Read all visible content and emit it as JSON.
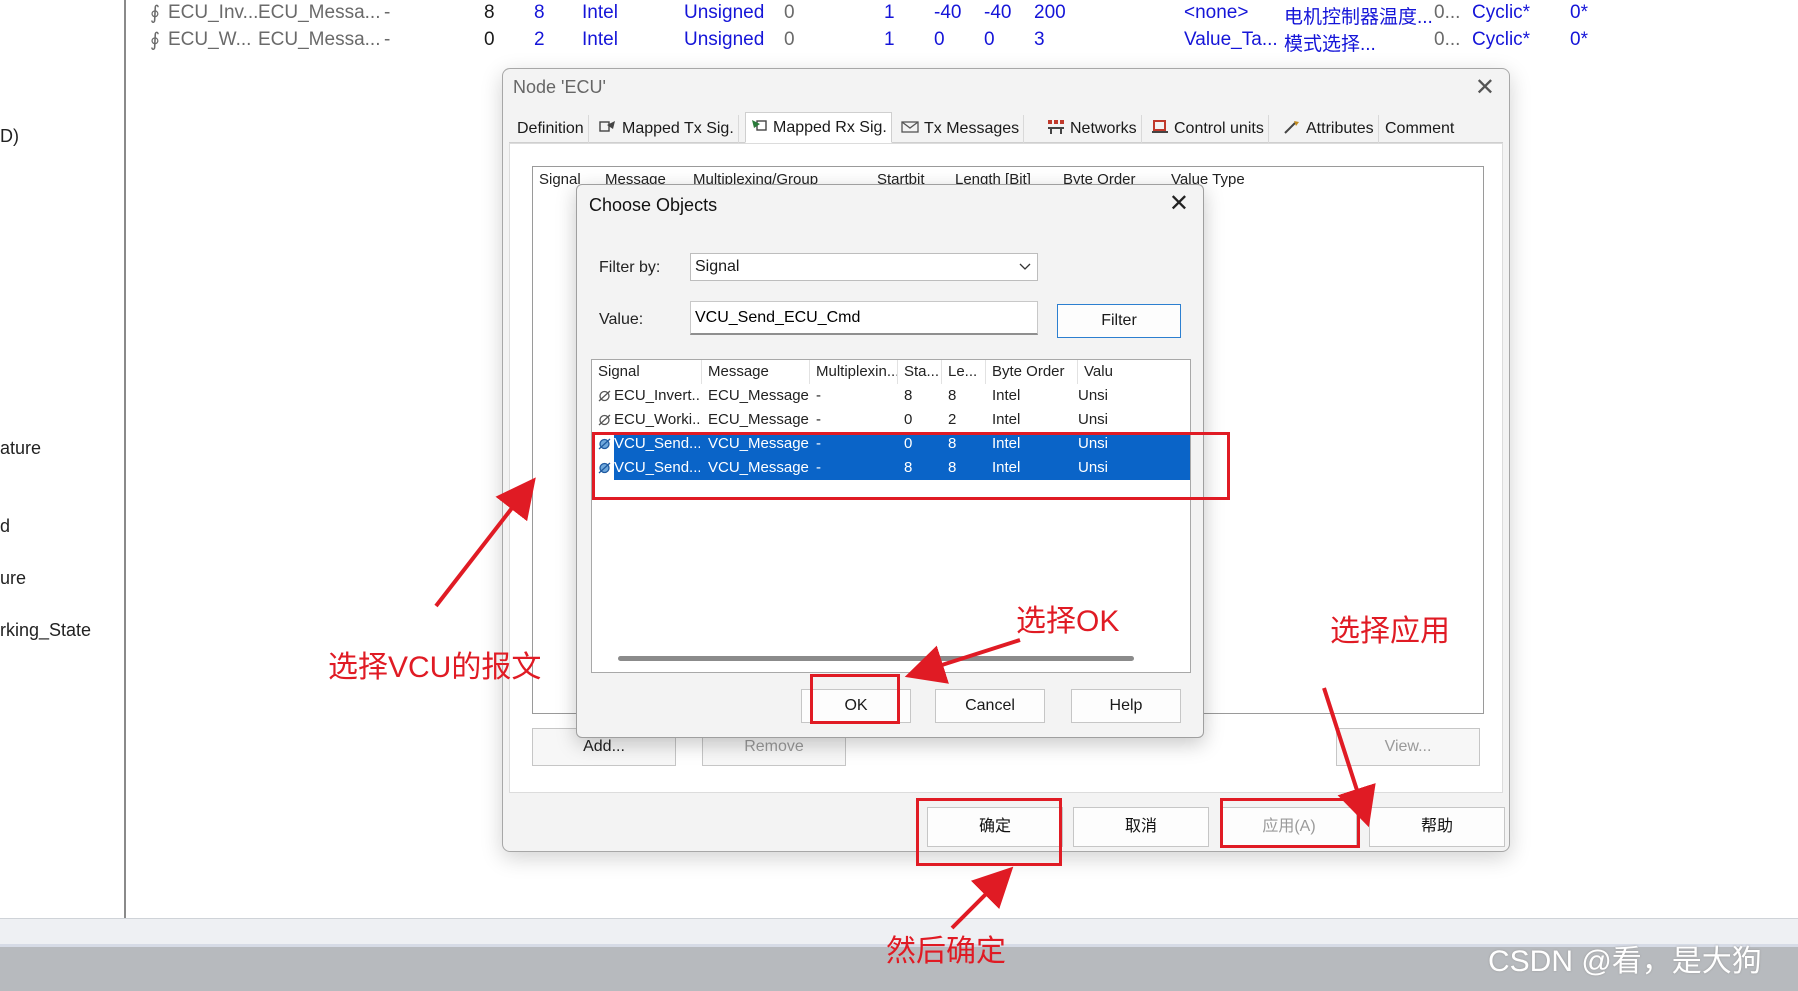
{
  "left_tree": {
    "items": [
      "D)",
      "ature",
      "d",
      "ure",
      "rking_State"
    ]
  },
  "bg_table": {
    "rows": [
      {
        "signal": "ECU_Inv...",
        "message": "ECU_Messa...",
        "mux": "-",
        "start": "8",
        "length": "8",
        "order": "Intel",
        "type": "Unsigned",
        "init": "0",
        "factor": "1",
        "offset": "-40",
        "min": "-40",
        "max": "200",
        "unit": "<none>",
        "comment": "电机控制器温度...",
        "cycle": "0...",
        "tx": "Cyclic*",
        "cyc": "0*"
      },
      {
        "signal": "ECU_W...",
        "message": "ECU_Messa...",
        "mux": "-",
        "start": "0",
        "length": "2",
        "order": "Intel",
        "type": "Unsigned",
        "init": "0",
        "factor": "1",
        "offset": "0",
        "min": "0",
        "max": "3",
        "unit": "Value_Ta...",
        "comment": "模式选择...",
        "cycle": "0...",
        "tx": "Cyclic*",
        "cyc": "0*"
      }
    ]
  },
  "node_dialog": {
    "title": "Node 'ECU'",
    "tabs": [
      "Definition",
      "Mapped Tx Sig.",
      "Mapped Rx Sig.",
      "Tx Messages",
      "Networks",
      "Control units",
      "Attributes",
      "Comment"
    ],
    "grid_headers": [
      "Signal",
      "Message",
      "Multiplexing/Group",
      "Startbit",
      "Length [Bit]",
      "Byte Order",
      "Value Type"
    ],
    "add_label": "Add...",
    "remove_label": "Remove",
    "view_label": "View...",
    "ok_label": "确定",
    "cancel_label": "取消",
    "apply_label": "应用(A)",
    "help_label": "帮助"
  },
  "choose_dialog": {
    "title": "Choose Objects",
    "filter_by_label": "Filter by:",
    "filter_by_value": "Signal",
    "value_label": "Value:",
    "value_text": "VCU_Send_ECU_Cmd",
    "filter_button": "Filter",
    "columns": [
      "Signal",
      "Message",
      "Multiplexin...",
      "Sta...",
      "Le...",
      "Byte Order",
      "Valu"
    ],
    "rows": [
      {
        "signal": "ECU_Invert...",
        "message": "ECU_Message",
        "mux": "-",
        "start": "8",
        "length": "8",
        "order": "Intel",
        "type": "Unsi",
        "selected": false
      },
      {
        "signal": "ECU_Worki...",
        "message": "ECU_Message",
        "mux": "-",
        "start": "0",
        "length": "2",
        "order": "Intel",
        "type": "Unsi",
        "selected": false
      },
      {
        "signal": "VCU_Send...",
        "message": "VCU_Message",
        "mux": "-",
        "start": "0",
        "length": "8",
        "order": "Intel",
        "type": "Unsi",
        "selected": true
      },
      {
        "signal": "VCU_Send...",
        "message": "VCU_Message",
        "mux": "-",
        "start": "8",
        "length": "8",
        "order": "Intel",
        "type": "Unsi",
        "selected": true
      }
    ],
    "ok_label": "OK",
    "cancel_label": "Cancel",
    "help_label": "Help"
  },
  "annotations": {
    "select_vcu": "选择VCU的报文",
    "select_ok": "选择OK",
    "select_apply": "选择应用",
    "then_confirm": "然后确定",
    "color": "#e01b24"
  },
  "watermark": "CSDN @看，是大狗"
}
